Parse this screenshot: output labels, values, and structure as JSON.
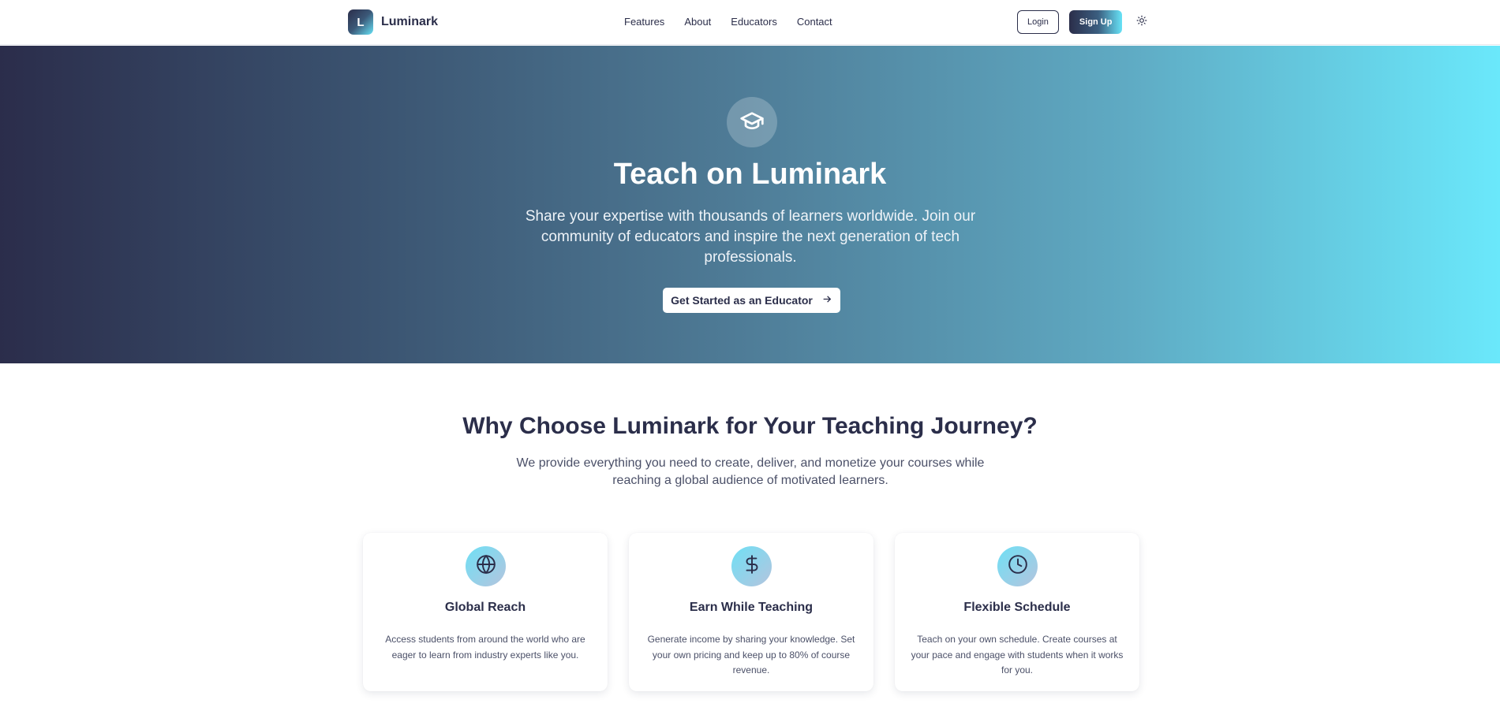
{
  "nav": {
    "brand_letter": "L",
    "brand_name": "Luminark",
    "links": [
      "Features",
      "About",
      "Educators",
      "Contact"
    ],
    "login_label": "Login",
    "signup_label": "Sign Up",
    "theme_icon": "sun-icon"
  },
  "hero": {
    "icon": "graduation-cap-icon",
    "title": "Teach on Luminark",
    "subtitle": "Share your expertise with thousands of learners worldwide. Join our community of educators and inspire the next generation of tech professionals.",
    "cta_label": "Get Started as an Educator",
    "cta_icon": "arrow-right-icon"
  },
  "why": {
    "title": "Why Choose Luminark for Your Teaching Journey?",
    "subtitle": "We provide everything you need to create, deliver, and monetize your courses while reaching a global audience of motivated learners.",
    "cards": [
      {
        "icon": "globe-icon",
        "title": "Global Reach",
        "description": "Access students from around the world who are eager to learn from industry experts like you."
      },
      {
        "icon": "dollar-icon",
        "title": "Earn While Teaching",
        "description": "Generate income by sharing your knowledge. Set your own pricing and keep up to 80% of course revenue."
      },
      {
        "icon": "clock-icon",
        "title": "Flexible Schedule",
        "description": "Teach on your own schedule. Create courses at your pace and engage with students when it works for you."
      }
    ]
  },
  "colors": {
    "brand_dark": "#2b2e4a",
    "brand_cyan": "#67e3f7",
    "text_muted": "#4b5068"
  }
}
